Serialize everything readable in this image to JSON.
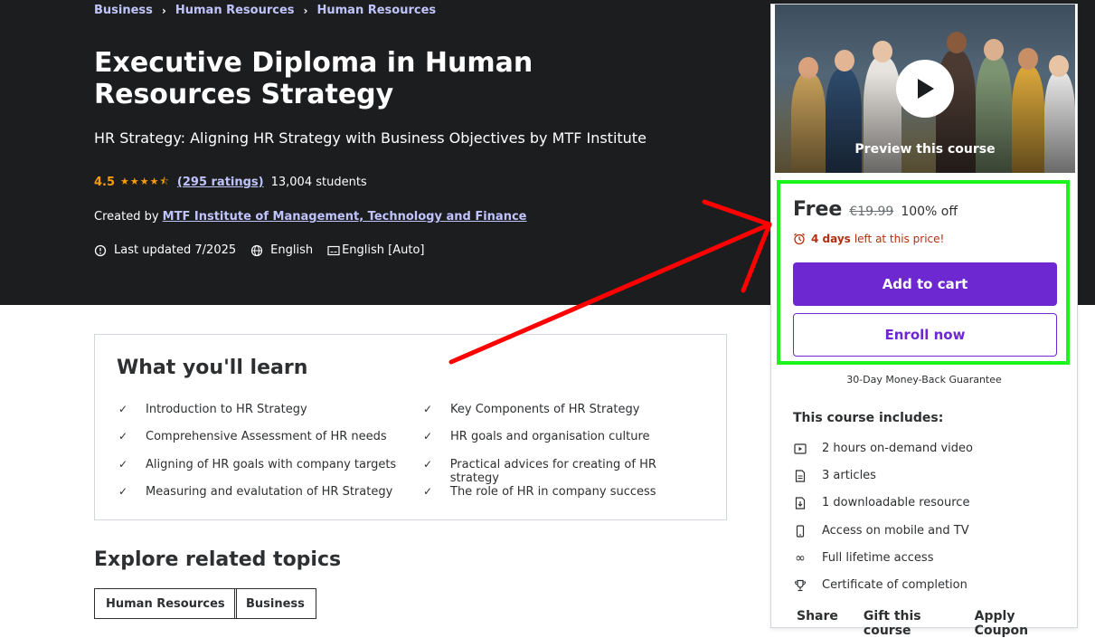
{
  "breadcrumb": [
    "Business",
    "Human Resources",
    "Human Resources"
  ],
  "course": {
    "title": "Executive Diploma in Human Resources Strategy",
    "subtitle": "HR Strategy: Aligning HR Strategy with Business Objectives by MTF Institute",
    "rating": "4.5",
    "ratings_count": "(295 ratings)",
    "students": "13,004 students",
    "created_by_label": "Created by",
    "author": "MTF Institute of Management, Technology and Finance",
    "last_updated": "Last updated 7/2025",
    "language": "English",
    "captions": "English [Auto]"
  },
  "learn": {
    "title": "What you'll learn",
    "items": [
      "Introduction to HR Strategy",
      "Key Components of HR Strategy",
      "Comprehensive Assessment of HR needs",
      "HR goals and organisation culture",
      "Aligning of HR goals with company targets",
      "Practical advices for creating of HR strategy",
      "Measuring and evalutation of HR Strategy",
      "The role of HR in company success"
    ]
  },
  "related": {
    "title": "Explore related topics",
    "topics": [
      "Human Resources",
      "Business"
    ]
  },
  "card": {
    "preview_label": "Preview this course",
    "price": "Free",
    "old_price": "€19.99",
    "discount": "100% off",
    "timer_days": "4 days",
    "timer_text": "left at this price!",
    "add_to_cart": "Add to cart",
    "enroll": "Enroll now",
    "guarantee": "30-Day Money-Back Guarantee",
    "includes_title": "This course includes:",
    "includes": [
      {
        "icon": "video-icon",
        "text": "2 hours on-demand video"
      },
      {
        "icon": "article-icon",
        "text": "3 articles"
      },
      {
        "icon": "download-icon",
        "text": "1 downloadable resource"
      },
      {
        "icon": "mobile-icon",
        "text": "Access on mobile and TV"
      },
      {
        "icon": "infinity-icon",
        "text": "Full lifetime access"
      },
      {
        "icon": "trophy-icon",
        "text": "Certificate of completion"
      }
    ],
    "links": [
      "Share",
      "Gift this course",
      "Apply Coupon"
    ]
  },
  "colors": {
    "hero_bg": "#1c1d1f",
    "link": "#c0c4fc",
    "star": "#f69c08",
    "primary": "#6d28d2",
    "timer": "#b32d0f",
    "annotation_box": "#1cf51c",
    "annotation_arrow": "#ff0000"
  }
}
